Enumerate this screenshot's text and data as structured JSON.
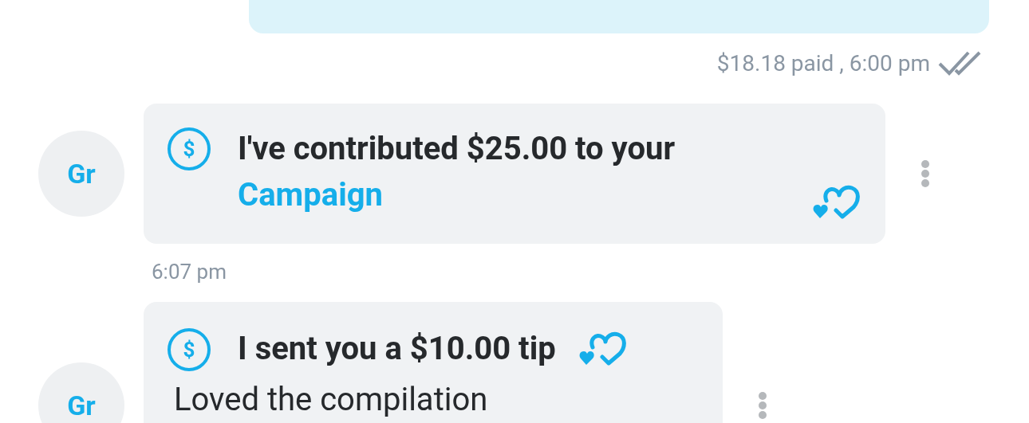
{
  "previous_message": {
    "meta": "$18.18 paid , 6:00 pm",
    "read": true
  },
  "messages": [
    {
      "kind": "contribution",
      "avatar": "Gr",
      "icon": "$",
      "text": "I've contributed $25.00 to your",
      "link": "Campaign",
      "liked": true,
      "time": "6:07 pm"
    },
    {
      "kind": "tip",
      "avatar": "Gr",
      "icon": "$",
      "text": "I sent you a $10.00 tip",
      "caption": "Loved the compilation",
      "liked": true
    }
  ]
}
